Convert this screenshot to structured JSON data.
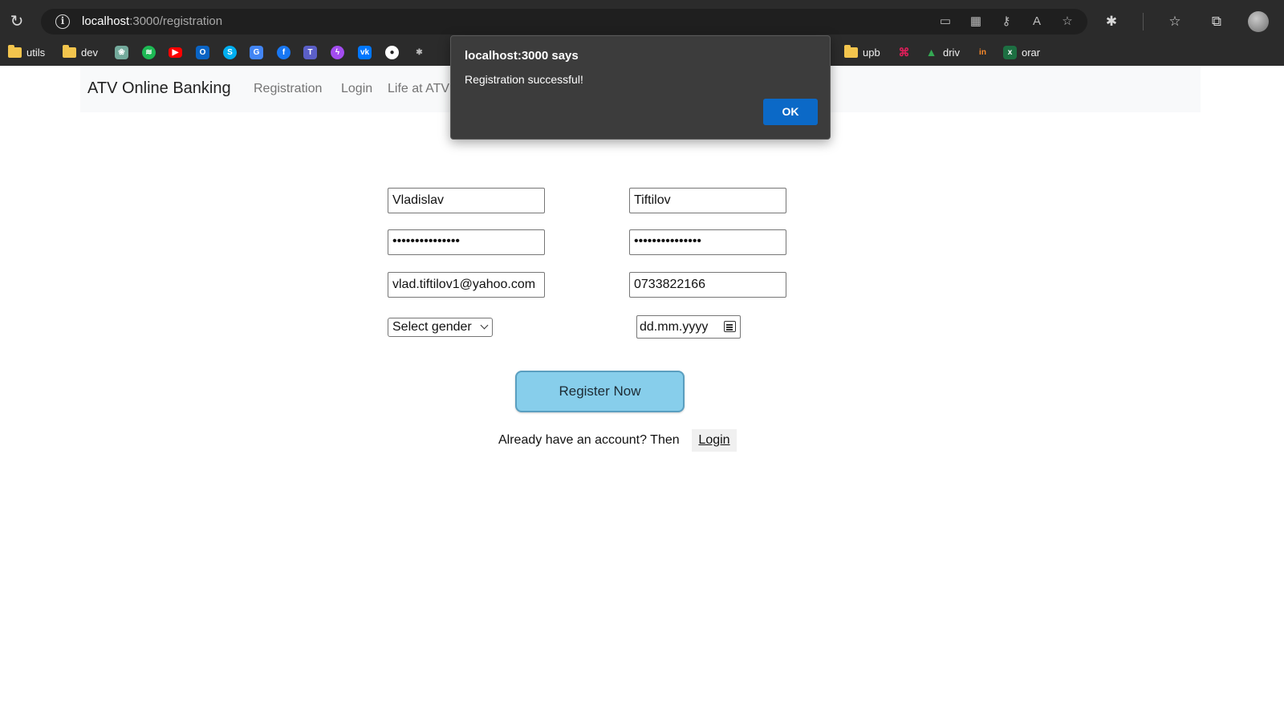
{
  "browser": {
    "url_host": "localhost",
    "url_rest": ":3000/registration",
    "bookmarks": [
      {
        "label": "utils",
        "icon": "folder-icon"
      },
      {
        "label": "dev",
        "icon": "folder-icon"
      },
      {
        "label": "",
        "icon": "chatgpt-icon"
      },
      {
        "label": "",
        "icon": "spotify-icon"
      },
      {
        "label": "",
        "icon": "youtube-icon"
      },
      {
        "label": "",
        "icon": "outlook-icon"
      },
      {
        "label": "",
        "icon": "skype-icon"
      },
      {
        "label": "",
        "icon": "translate-icon"
      },
      {
        "label": "",
        "icon": "facebook-icon"
      },
      {
        "label": "",
        "icon": "teams-icon"
      },
      {
        "label": "",
        "icon": "messenger-icon"
      },
      {
        "label": "",
        "icon": "vk-icon"
      },
      {
        "label": "",
        "icon": "github-icon"
      },
      {
        "label": "",
        "icon": "puzzle-icon"
      },
      {
        "label": "upb",
        "icon": "folder-icon"
      },
      {
        "label": "",
        "icon": "slack-icon"
      },
      {
        "label": "driv",
        "icon": "drive-icon"
      },
      {
        "label": "",
        "icon": "invision-icon"
      },
      {
        "label": "orar",
        "icon": "excel-icon"
      }
    ]
  },
  "navbar": {
    "brand": "ATV Online Banking",
    "links": [
      "Registration",
      "Login",
      "Life at ATV"
    ]
  },
  "form": {
    "first_name": "Vladislav",
    "last_name": "Tiftilov",
    "password": "•••••••••••••••",
    "confirm_password": "•••••••••••••••",
    "email": "vlad.tiftilov1@yahoo.com",
    "phone": "0733822166",
    "gender_selected": "Select gender",
    "date_placeholder": "dd.mm.yyyy",
    "register_label": "Register Now",
    "already_text": "Already have an account? Then",
    "login_label": "Login"
  },
  "alert": {
    "title": "localhost:3000 says",
    "message": "Registration successful!",
    "ok_label": "OK"
  }
}
